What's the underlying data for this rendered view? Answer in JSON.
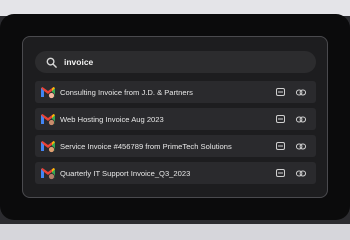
{
  "search": {
    "icon": "search-icon",
    "value": "invoice"
  },
  "results": [
    {
      "title": "Consulting Invoice from J.D. & Partners",
      "icon": "gmail-icon",
      "actions": [
        "message-icon",
        "link-icon"
      ]
    },
    {
      "title": "Web Hosting Invoice Aug 2023",
      "icon": "gmail-icon",
      "actions": [
        "message-icon",
        "link-icon"
      ]
    },
    {
      "title": "Service Invoice #456789 from PrimeTech Solutions",
      "icon": "gmail-icon",
      "actions": [
        "message-icon",
        "link-icon"
      ]
    },
    {
      "title": "Quarterly IT Support Invoice_Q3_2023",
      "icon": "gmail-icon",
      "actions": [
        "message-icon",
        "link-icon"
      ]
    }
  ],
  "colors": {
    "gmail_red": "#ea4335",
    "gmail_blue": "#4285f4",
    "gmail_green": "#34a853",
    "gmail_yellow": "#fbbc04",
    "panel_bg": "#1d1d1f",
    "row_bg": "#2a2a2d"
  }
}
